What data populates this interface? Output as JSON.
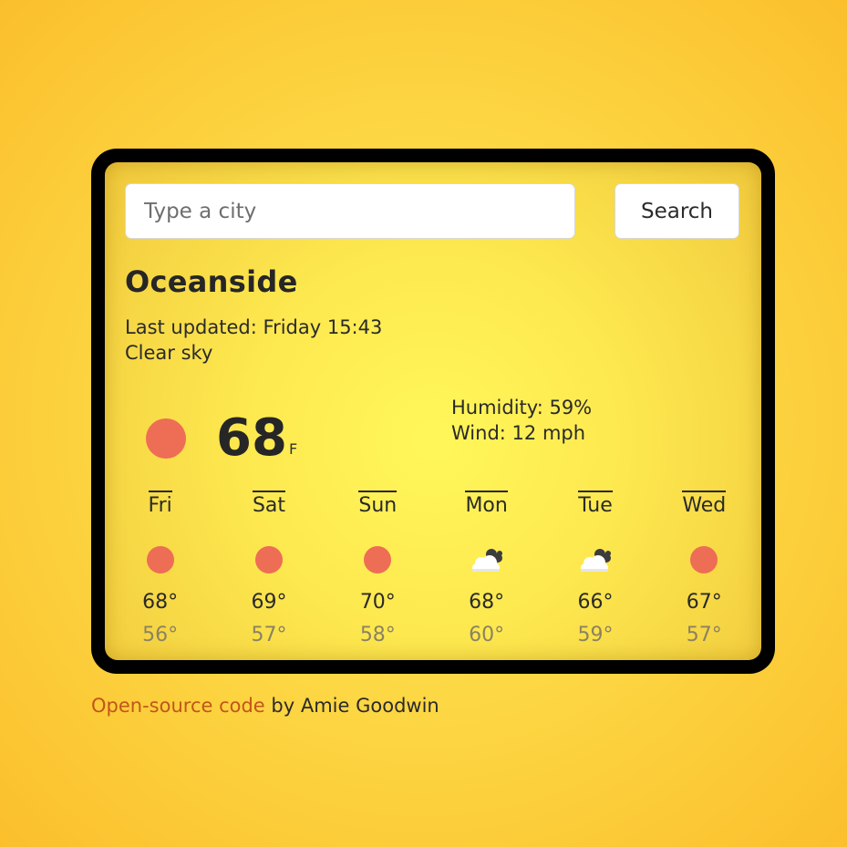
{
  "search": {
    "placeholder": "Type a city",
    "value": "",
    "button_label": "Search"
  },
  "current": {
    "city": "Oceanside",
    "updated_label": "Last updated:",
    "updated_time": "Friday 15:43",
    "description": "Clear sky",
    "icon": "sun-icon",
    "temperature": "68",
    "unit": "F",
    "humidity_label": "Humidity:",
    "humidity": "59%",
    "wind_label": "Wind:",
    "wind": "12 mph"
  },
  "forecast": [
    {
      "day": "Fri",
      "icon": "sun-icon",
      "max": "68°",
      "min": "56°"
    },
    {
      "day": "Sat",
      "icon": "sun-icon",
      "max": "69°",
      "min": "57°"
    },
    {
      "day": "Sun",
      "icon": "sun-icon",
      "max": "70°",
      "min": "58°"
    },
    {
      "day": "Mon",
      "icon": "cloud-icon",
      "max": "68°",
      "min": "60°"
    },
    {
      "day": "Tue",
      "icon": "cloud-icon",
      "max": "66°",
      "min": "59°"
    },
    {
      "day": "Wed",
      "icon": "sun-icon",
      "max": "67°",
      "min": "57°"
    }
  ],
  "footer": {
    "link_text": "Open-source code",
    "credit_text": " by Amie Goodwin"
  },
  "colors": {
    "sun": "#ee6d55",
    "link": "#c0561b",
    "frame": "#000000",
    "background": "#fdd845",
    "min_temp": "#8b8262"
  }
}
